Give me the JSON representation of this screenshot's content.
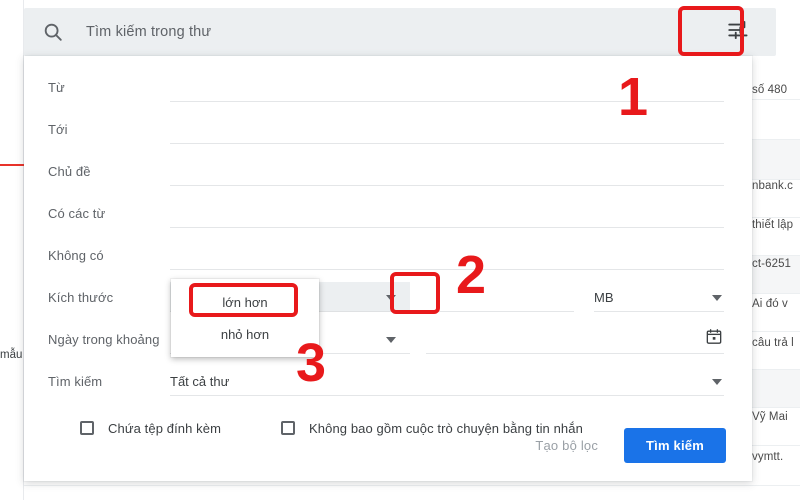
{
  "app": {
    "name": "gmail-advanced-search",
    "accent_blue": "#1a73e8",
    "annotation_red": "#e8191b",
    "searchbar_bg": "#eceff1"
  },
  "search": {
    "placeholder": "Tìm kiếm trong thư",
    "search_icon": "search-icon",
    "tune_icon": "tune-filter-icon"
  },
  "form": {
    "rows": [
      {
        "label": "Từ",
        "value": ""
      },
      {
        "label": "Tới",
        "value": ""
      },
      {
        "label": "Chủ đề",
        "value": ""
      },
      {
        "label": "Có các từ",
        "value": ""
      },
      {
        "label": "Không có",
        "value": ""
      }
    ],
    "size": {
      "label": "Kích thước",
      "comparator_value": "",
      "amount_value": "",
      "unit_value": "MB",
      "caret_icon": "chevron-down-icon",
      "unit_caret_icon": "chevron-down-icon"
    },
    "date": {
      "label": "Ngày trong khoảng",
      "range_value": "",
      "date_value": "",
      "caret_icon": "chevron-down-icon",
      "calendar_icon": "calendar-icon"
    },
    "search_in": {
      "label": "Tìm kiếm",
      "value": "Tất cả thư",
      "caret_icon": "chevron-down-icon"
    }
  },
  "checkboxes": [
    {
      "label": "Chứa tệp đính kèm",
      "checked": false
    },
    {
      "label": "Không bao gồm cuộc trò chuyện bằng tin nhắn",
      "checked": false
    }
  ],
  "actions": {
    "create_filter_label": "Tạo bộ lọc",
    "search_label": "Tìm kiếm"
  },
  "dropdown_menu": {
    "items": [
      {
        "label": "lớn hơn",
        "highlighted": true
      },
      {
        "label": "nhỏ hơn",
        "highlighted": false
      }
    ]
  },
  "annotations": {
    "numbers": [
      {
        "text": "1",
        "target": "tune-filter-button"
      },
      {
        "text": "2",
        "target": "size-comparator-caret"
      },
      {
        "text": "3",
        "target": "menu-item-lon-hon"
      }
    ]
  },
  "background": {
    "right_fragments": [
      "số 480",
      "nbank.c",
      "thiết lập",
      "ct-6251",
      "Ai đó v",
      "câu trả l",
      "Vỹ Mai",
      "vymtt."
    ],
    "left_fragments": [
      "mẫu"
    ]
  }
}
